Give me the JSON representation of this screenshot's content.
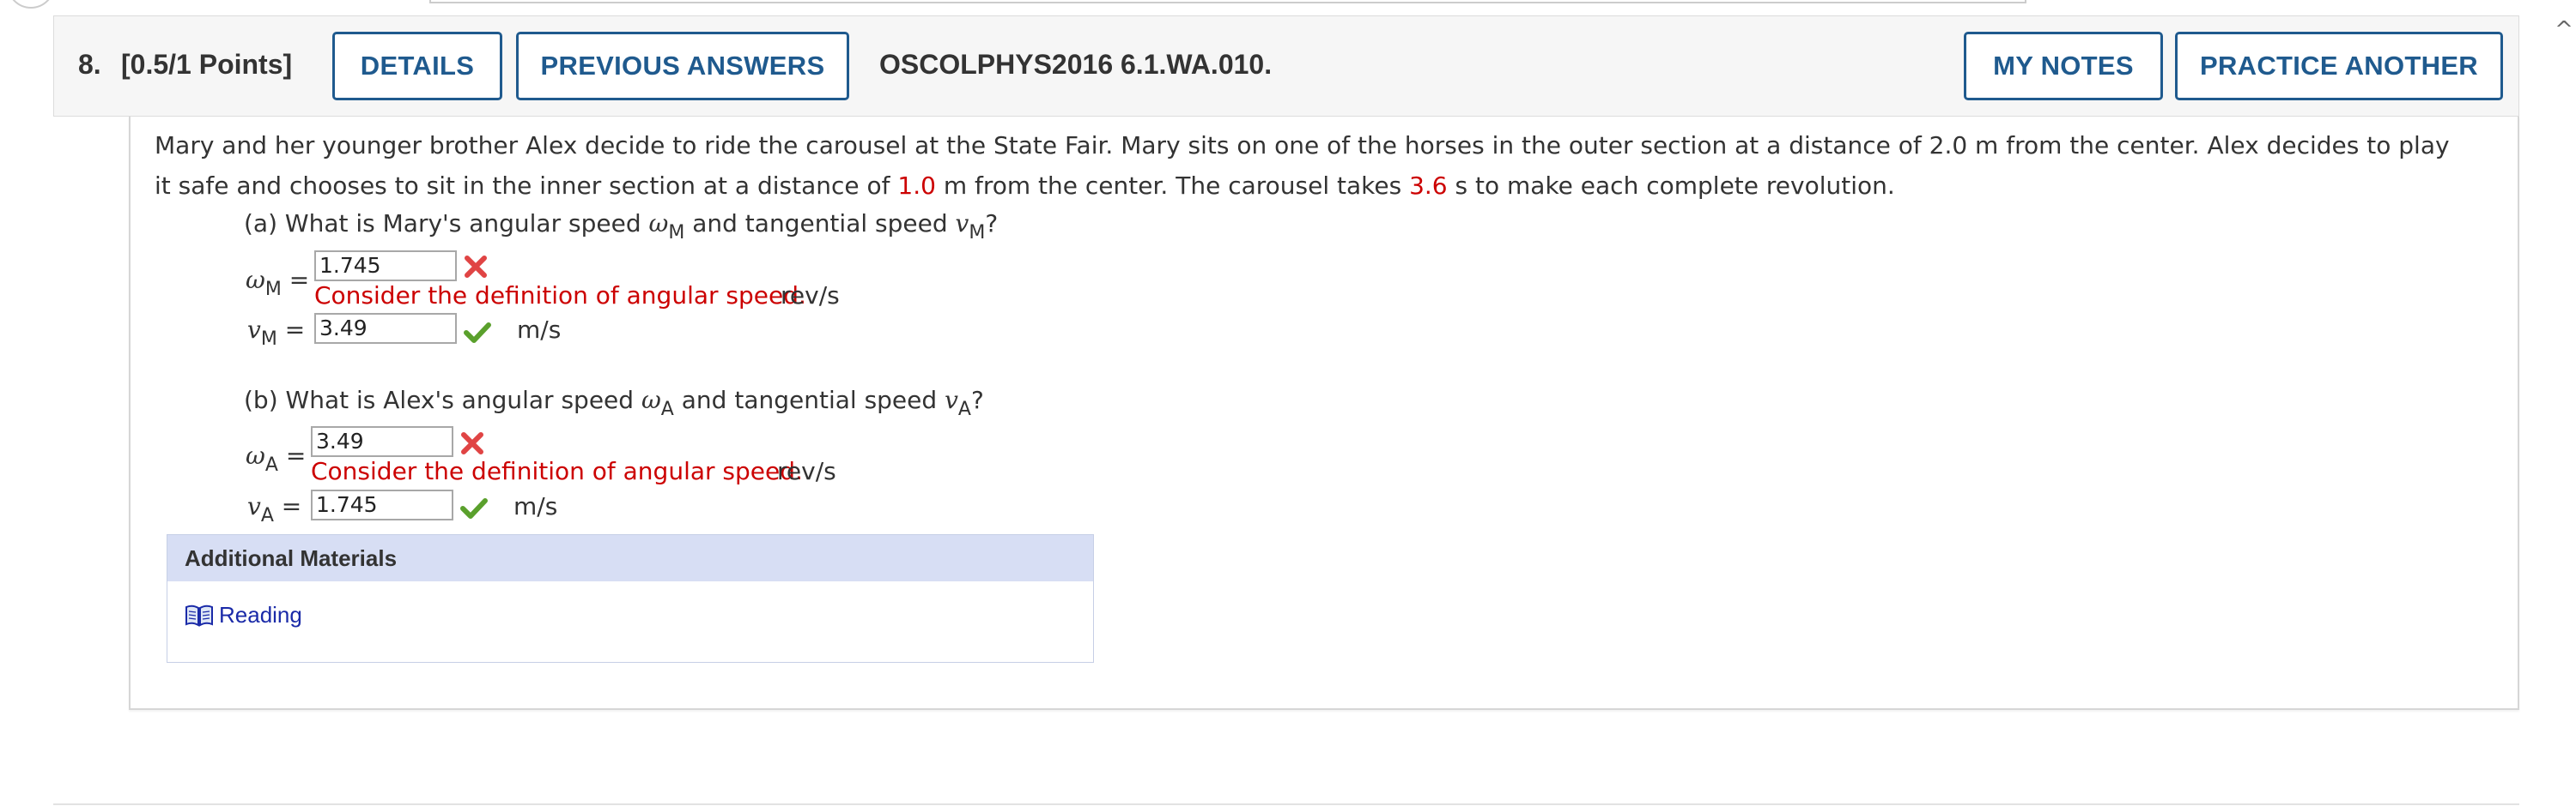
{
  "question": {
    "number": "8.",
    "points": "[0.5/1 Points]",
    "code": "OSCOLPHYS2016 6.1.WA.010."
  },
  "buttons": {
    "details": "DETAILS",
    "previous_answers": "PREVIOUS ANSWERS",
    "my_notes": "MY NOTES",
    "practice_another": "PRACTICE ANOTHER"
  },
  "problem": {
    "text_1": "Mary and her younger brother Alex decide to ride the carousel at the State Fair. Mary sits on one of the horses in the outer section at a distance of 2.0 m from the center. Alex decides to play it safe and chooses to sit in the inner section at a distance of ",
    "value_1": "1.0",
    "text_2": " m from the center. The carousel takes ",
    "value_2": "3.6",
    "text_3": " s to make each complete revolution."
  },
  "part_a": {
    "question_start": "(a) What is Mary's angular speed ",
    "question_mid": " and tangential speed ",
    "question_end": "?",
    "omega_symbol": "ω",
    "v_symbol": "v",
    "subscript": "M",
    "equals": "=",
    "omega_answer": "1.745",
    "omega_status": "incorrect",
    "omega_feedback": "Consider the definition of angular speed.",
    "omega_unit": "rev/s",
    "v_answer": "3.49",
    "v_status": "correct",
    "v_unit": "m/s"
  },
  "part_b": {
    "question_start": "(b) What is Alex's angular speed ",
    "question_mid": " and tangential speed ",
    "question_end": "?",
    "omega_symbol": "ω",
    "v_symbol": "v",
    "subscript": "A",
    "equals": "=",
    "omega_answer": "3.49",
    "omega_status": "incorrect",
    "omega_feedback": "Consider the definition of angular speed.",
    "omega_unit": "rev/s",
    "v_answer": "1.745",
    "v_status": "correct",
    "v_unit": "m/s"
  },
  "materials": {
    "heading": "Additional Materials",
    "link": "Reading",
    "link_icon": "book-icon"
  },
  "colors": {
    "button_border": "#1f5a8e",
    "error_red": "#cc0000",
    "check_green": "#5aa02c",
    "x_red": "#e04444",
    "materials_header": "#d7def4",
    "link_blue": "#1a2aa8"
  }
}
